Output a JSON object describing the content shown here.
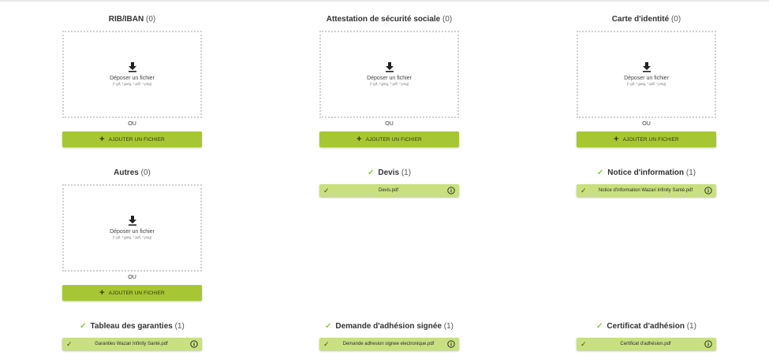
{
  "colors": {
    "accent": "#a6c634",
    "file_row": "#c8e07e",
    "check": "#8dc63f"
  },
  "common": {
    "drop_text": "Déposer un fichier",
    "drop_formats": "(*.gif, *.jpeg, *.pdf, *.png)",
    "or_text": "OU",
    "add_label": "AJOUTER UN FICHIER",
    "icons": {
      "download": "download-icon",
      "plus": "plus-icon",
      "check": "check-icon",
      "info": "info-icon"
    }
  },
  "sections": [
    {
      "title": "RIB/IBAN",
      "count": "(0)",
      "state": "empty"
    },
    {
      "title": "Attestation de sécurité sociale",
      "count": "(0)",
      "state": "empty"
    },
    {
      "title": "Carte d'identité",
      "count": "(0)",
      "state": "empty"
    },
    {
      "title": "Autres",
      "count": "(0)",
      "state": "empty"
    },
    {
      "title": "Devis",
      "count": "(1)",
      "state": "filled",
      "file": "Devis.pdf"
    },
    {
      "title": "Notice d'information",
      "count": "(1)",
      "state": "filled",
      "file": "Notice d'information Wazari Infinity Santé.pdf"
    },
    {
      "title": "Tableau des garanties",
      "count": "(1)",
      "state": "filled",
      "file": "Garanties Wazari Infinity Santé.pdf"
    },
    {
      "title": "Demande d'adhésion signée",
      "count": "(1)",
      "state": "filled",
      "file": "Demande adhesion signee electronique.pdf"
    },
    {
      "title": "Certificat d'adhésion",
      "count": "(1)",
      "state": "filled",
      "file": "Certificat d'adhésion.pdf"
    }
  ]
}
